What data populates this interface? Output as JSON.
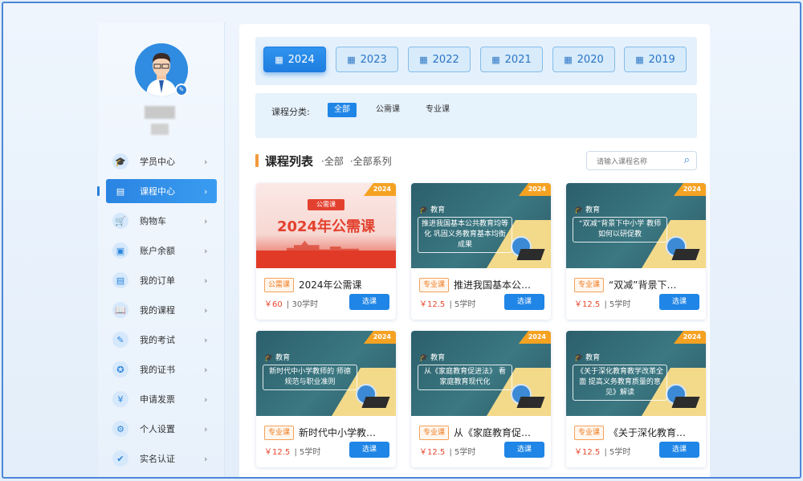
{
  "sidebar": {
    "items": [
      {
        "label": "学员中心",
        "icon": "graduation-cap-icon",
        "glyph": "🎓",
        "active": false
      },
      {
        "label": "课程中心",
        "icon": "course-book-icon",
        "glyph": "▤",
        "active": true
      },
      {
        "label": "购物车",
        "icon": "cart-icon",
        "glyph": "🛒",
        "active": false
      },
      {
        "label": "账户余额",
        "icon": "wallet-icon",
        "glyph": "▣",
        "active": false
      },
      {
        "label": "我的订单",
        "icon": "order-icon",
        "glyph": "▤",
        "active": false
      },
      {
        "label": "我的课程",
        "icon": "book-icon",
        "glyph": "📖",
        "active": false
      },
      {
        "label": "我的考试",
        "icon": "exam-icon",
        "glyph": "✎",
        "active": false
      },
      {
        "label": "我的证书",
        "icon": "certificate-icon",
        "glyph": "✪",
        "active": false
      },
      {
        "label": "申请发票",
        "icon": "invoice-icon",
        "glyph": "¥",
        "active": false
      },
      {
        "label": "个人设置",
        "icon": "gear-icon",
        "glyph": "⚙",
        "active": false
      },
      {
        "label": "实名认证",
        "icon": "verify-icon",
        "glyph": "✔",
        "active": false
      }
    ],
    "chevron": "›"
  },
  "years": {
    "items": [
      "2024",
      "2023",
      "2022",
      "2021",
      "2020",
      "2019"
    ],
    "active": "2024",
    "icon": "calendar-icon"
  },
  "filter": {
    "label": "课程分类:",
    "options": [
      "全部",
      "公需课",
      "专业课"
    ],
    "active": "全部"
  },
  "list": {
    "title": "课程列表",
    "crumb1": "·全部",
    "crumb2": "·全部系列"
  },
  "search": {
    "placeholder": "请输入课程名称",
    "icon": "search-icon"
  },
  "courses": [
    {
      "year": "2024",
      "tag": "公需课",
      "title": "2024年公需课",
      "price": "￥60",
      "hours": "30学时",
      "button": "选课",
      "thumb_style": "red",
      "thumb_tag": "公需课",
      "thumb_title": "2024年公需课",
      "thumb_edu": "",
      "thumb_text": ""
    },
    {
      "year": "2024",
      "tag": "专业课",
      "title": "推进我国基本公…",
      "price": "￥12.5",
      "hours": "5学时",
      "button": "选课",
      "thumb_style": "teal",
      "thumb_edu": "教育",
      "thumb_text": "推进我国基本公共教育均等化 巩固义务教育基本均衡成果"
    },
    {
      "year": "2024",
      "tag": "专业课",
      "title": "“双减”背景下…",
      "price": "￥12.5",
      "hours": "5学时",
      "button": "选课",
      "thumb_style": "teal",
      "thumb_edu": "教育",
      "thumb_text": "“双减”背景下中小学 教师如何以研促教"
    },
    {
      "year": "2024",
      "tag": "专业课",
      "title": "新时代中小学教…",
      "price": "￥12.5",
      "hours": "5学时",
      "button": "选课",
      "thumb_style": "teal",
      "thumb_edu": "教育",
      "thumb_text": "新时代中小学教师的 师德规范与职业准则"
    },
    {
      "year": "2024",
      "tag": "专业课",
      "title": "从《家庭教育促…",
      "price": "￥12.5",
      "hours": "5学时",
      "button": "选课",
      "thumb_style": "teal",
      "thumb_edu": "教育",
      "thumb_text": "从《家庭教育促进法》 看家庭教育现代化"
    },
    {
      "year": "2024",
      "tag": "专业课",
      "title": "《关于深化教育…",
      "price": "￥12.5",
      "hours": "5学时",
      "button": "选课",
      "thumb_style": "teal",
      "thumb_edu": "教育",
      "thumb_text": "《关于深化教育教学改革全面 提高义务教育质量的意见》解读"
    }
  ]
}
